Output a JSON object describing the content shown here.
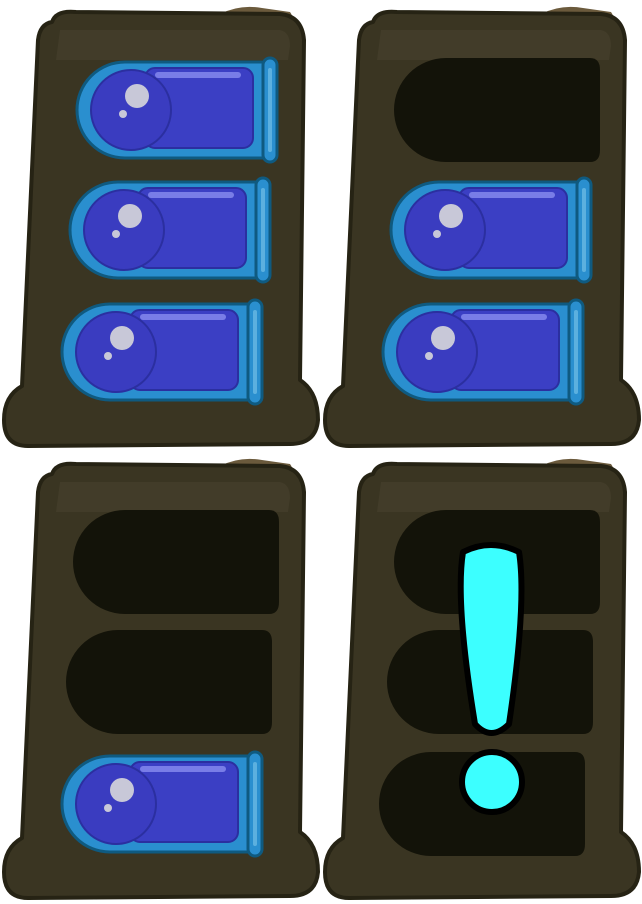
{
  "colors": {
    "magazine_body": "#3a3522",
    "magazine_outline": "#262314",
    "magazine_highlight": "#4a4430",
    "magazine_top_tab": "#6b5a3c",
    "slot_empty": "#131309",
    "bullet_casing": "#2a8fcf",
    "bullet_casing_outline": "#0f5a80",
    "bullet_panel": "#3b3fc4",
    "bullet_tip": "#3a3cc0",
    "bullet_shine": "#c8c8d8",
    "alert_fill": "#3cffff",
    "alert_outline": "#000000"
  },
  "magazines": [
    {
      "id": "mag-full",
      "capacity": 3,
      "loaded": 3,
      "alert": false,
      "state_icon": "magazine-full-icon"
    },
    {
      "id": "mag-two",
      "capacity": 3,
      "loaded": 2,
      "alert": false,
      "state_icon": "magazine-two-rounds-icon"
    },
    {
      "id": "mag-one",
      "capacity": 3,
      "loaded": 1,
      "alert": false,
      "state_icon": "magazine-one-round-icon"
    },
    {
      "id": "mag-empty",
      "capacity": 3,
      "loaded": 0,
      "alert": true,
      "state_icon": "magazine-empty-alert-icon"
    }
  ]
}
